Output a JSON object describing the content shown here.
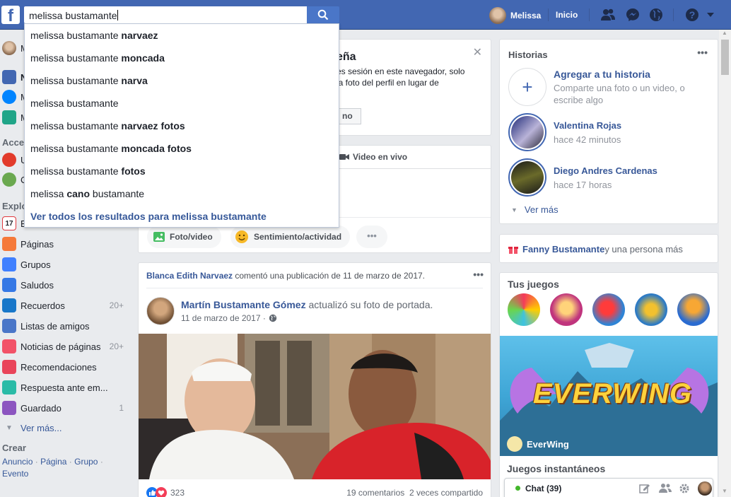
{
  "search": {
    "value": "melissa bustamante",
    "suggestions": [
      {
        "pre": "melissa bustamante ",
        "bold": "narvaez",
        "post": ""
      },
      {
        "pre": "melissa bustamante ",
        "bold": "moncada",
        "post": ""
      },
      {
        "pre": "melissa bustamante ",
        "bold": "narva",
        "post": ""
      },
      {
        "pre": "melissa bustamante",
        "bold": "",
        "post": ""
      },
      {
        "pre": "melissa bustamante ",
        "bold": "narvaez fotos",
        "post": ""
      },
      {
        "pre": "melissa bustamante ",
        "bold": "moncada fotos",
        "post": ""
      },
      {
        "pre": "melissa bustamante ",
        "bold": "fotos",
        "post": ""
      },
      {
        "pre": "melissa ",
        "bold": "cano",
        "post": " bustamante"
      }
    ],
    "see_all": "Ver todos los resultados para melissa bustamante"
  },
  "topbar": {
    "user": "Melissa",
    "home": "Inicio"
  },
  "left": {
    "partial": [
      "M",
      "N",
      "M",
      "M"
    ],
    "acce": "Acce",
    "explo": "Explo",
    "acce_items": [
      "U",
      "C"
    ],
    "explo_first": "E",
    "items": [
      {
        "label": "Páginas",
        "count": "",
        "icon": "flag-icon",
        "color": "#f5793a"
      },
      {
        "label": "Grupos",
        "count": "",
        "icon": "groups-icon",
        "color": "#4080ff"
      },
      {
        "label": "Saludos",
        "count": "",
        "icon": "wave-icon",
        "color": "#3578e5"
      },
      {
        "label": "Recuerdos",
        "count": "20+",
        "icon": "memories-icon",
        "color": "#1877c9"
      },
      {
        "label": "Listas de amigos",
        "count": "",
        "icon": "friend-list-icon",
        "color": "#4a76c8"
      },
      {
        "label": "Noticias de páginas",
        "count": "20+",
        "icon": "page-news-icon",
        "color": "#f25268"
      },
      {
        "label": "Recomendaciones",
        "count": "",
        "icon": "recommend-icon",
        "color": "#e9445a"
      },
      {
        "label": "Respuesta ante em...",
        "count": "",
        "icon": "crisis-icon",
        "color": "#2abba7"
      },
      {
        "label": "Guardado",
        "count": "1",
        "icon": "bookmark-icon",
        "color": "#8c55c0"
      }
    ],
    "more": "Ver más...",
    "create_title": "Crear",
    "create_links": [
      "Anuncio",
      "Página",
      "Grupo",
      "Evento"
    ]
  },
  "notice": {
    "title": "eña",
    "line1": "es sesión en este navegador, solo",
    "line2": "la foto del perfil en lugar de",
    "btn": "no"
  },
  "composer": {
    "live": "Video en vivo",
    "photo": "Foto/video",
    "feeling": "Sentimiento/actividad"
  },
  "post": {
    "header_name": "Blanca Edith Narvaez",
    "header_rest": " comentó una publicación de 11 de marzo de 2017.",
    "author": "Martín Bustamante Gómez",
    "action": " actualizó su foto de portada.",
    "date": "11 de marzo de 2017 ·",
    "likes": "323",
    "comments": "19 comentarios",
    "shares": "2 veces compartido"
  },
  "stories": {
    "title": "Historias",
    "add_title": "Agregar a tu historia",
    "add_sub1": "Comparte una foto o un video, o",
    "add_sub2": "escribe algo",
    "items": [
      {
        "name": "Valentina Rojas",
        "time": "hace 42 minutos"
      },
      {
        "name": "Diego Andres Cardenas",
        "time": "hace 17 horas"
      }
    ],
    "more": "Ver más"
  },
  "birthday": {
    "name": "Fanny Bustamante",
    "rest": " y una persona más"
  },
  "games": {
    "title": "Tus juegos",
    "featured": "EverWing",
    "banner": "EVERWING",
    "instant": "Juegos instantáneos"
  },
  "chat": {
    "label": "Chat (39)"
  },
  "colors": {
    "brand": "#4267b2",
    "link": "#385898",
    "online": "#42b72a"
  }
}
